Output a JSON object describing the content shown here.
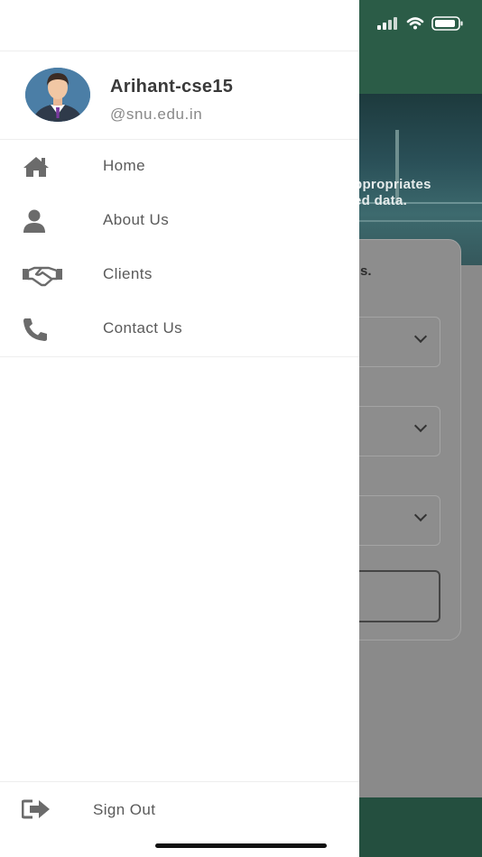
{
  "background_app": {
    "hero_text_line1": "ppropriates",
    "hero_text_line2": "ed data.",
    "card_text": "s."
  },
  "drawer": {
    "profile": {
      "name": "Arihant-cse15",
      "email": "@snu.edu.in",
      "avatar_icon": "businessman-avatar-icon"
    },
    "menu": [
      {
        "label": "Home",
        "icon": "home-icon"
      },
      {
        "label": "About Us",
        "icon": "user-icon"
      },
      {
        "label": "Clients",
        "icon": "handshake-icon"
      },
      {
        "label": "Contact Us",
        "icon": "phone-icon"
      }
    ],
    "signout": {
      "label": "Sign Out",
      "icon": "sign-out-icon"
    }
  },
  "colors": {
    "header_green": "#2b5c47",
    "footer_green": "#244f3f",
    "icon_gray": "#6b6b6b",
    "text_gray": "#5a5a5a"
  }
}
